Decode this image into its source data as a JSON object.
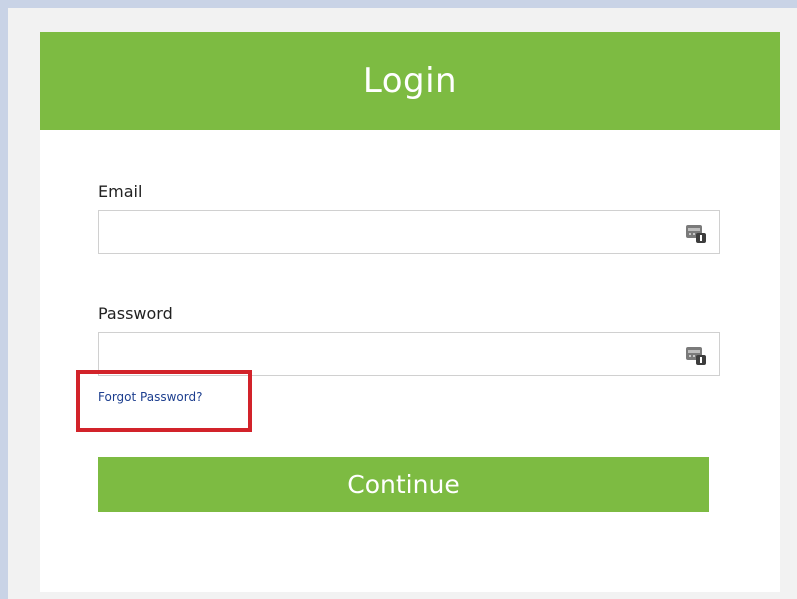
{
  "header": {
    "title": "Login",
    "color": "#7dbb42"
  },
  "email": {
    "label": "Email",
    "value": "",
    "icon": "password-manager-icon"
  },
  "password": {
    "label": "Password",
    "value": "",
    "icon": "password-manager-icon"
  },
  "forgot": {
    "label": "Forgot Password?"
  },
  "continue_button": {
    "label": "Continue"
  },
  "highlight": {
    "color": "#d2232a"
  }
}
